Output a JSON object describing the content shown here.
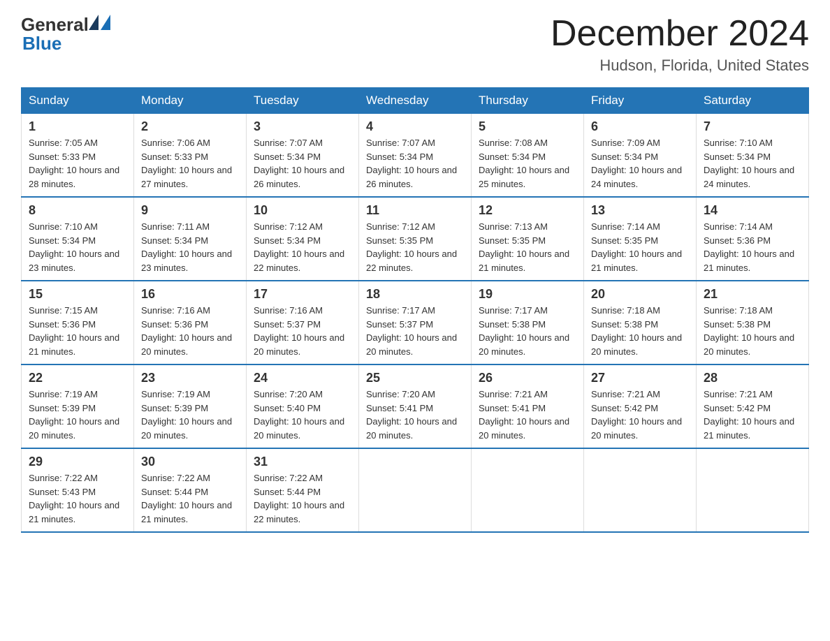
{
  "logo": {
    "general": "General",
    "blue": "Blue"
  },
  "title": "December 2024",
  "subtitle": "Hudson, Florida, United States",
  "days_header": [
    "Sunday",
    "Monday",
    "Tuesday",
    "Wednesday",
    "Thursday",
    "Friday",
    "Saturday"
  ],
  "weeks": [
    [
      {
        "num": "1",
        "sunrise": "7:05 AM",
        "sunset": "5:33 PM",
        "daylight": "10 hours and 28 minutes."
      },
      {
        "num": "2",
        "sunrise": "7:06 AM",
        "sunset": "5:33 PM",
        "daylight": "10 hours and 27 minutes."
      },
      {
        "num": "3",
        "sunrise": "7:07 AM",
        "sunset": "5:34 PM",
        "daylight": "10 hours and 26 minutes."
      },
      {
        "num": "4",
        "sunrise": "7:07 AM",
        "sunset": "5:34 PM",
        "daylight": "10 hours and 26 minutes."
      },
      {
        "num": "5",
        "sunrise": "7:08 AM",
        "sunset": "5:34 PM",
        "daylight": "10 hours and 25 minutes."
      },
      {
        "num": "6",
        "sunrise": "7:09 AM",
        "sunset": "5:34 PM",
        "daylight": "10 hours and 24 minutes."
      },
      {
        "num": "7",
        "sunrise": "7:10 AM",
        "sunset": "5:34 PM",
        "daylight": "10 hours and 24 minutes."
      }
    ],
    [
      {
        "num": "8",
        "sunrise": "7:10 AM",
        "sunset": "5:34 PM",
        "daylight": "10 hours and 23 minutes."
      },
      {
        "num": "9",
        "sunrise": "7:11 AM",
        "sunset": "5:34 PM",
        "daylight": "10 hours and 23 minutes."
      },
      {
        "num": "10",
        "sunrise": "7:12 AM",
        "sunset": "5:34 PM",
        "daylight": "10 hours and 22 minutes."
      },
      {
        "num": "11",
        "sunrise": "7:12 AM",
        "sunset": "5:35 PM",
        "daylight": "10 hours and 22 minutes."
      },
      {
        "num": "12",
        "sunrise": "7:13 AM",
        "sunset": "5:35 PM",
        "daylight": "10 hours and 21 minutes."
      },
      {
        "num": "13",
        "sunrise": "7:14 AM",
        "sunset": "5:35 PM",
        "daylight": "10 hours and 21 minutes."
      },
      {
        "num": "14",
        "sunrise": "7:14 AM",
        "sunset": "5:36 PM",
        "daylight": "10 hours and 21 minutes."
      }
    ],
    [
      {
        "num": "15",
        "sunrise": "7:15 AM",
        "sunset": "5:36 PM",
        "daylight": "10 hours and 21 minutes."
      },
      {
        "num": "16",
        "sunrise": "7:16 AM",
        "sunset": "5:36 PM",
        "daylight": "10 hours and 20 minutes."
      },
      {
        "num": "17",
        "sunrise": "7:16 AM",
        "sunset": "5:37 PM",
        "daylight": "10 hours and 20 minutes."
      },
      {
        "num": "18",
        "sunrise": "7:17 AM",
        "sunset": "5:37 PM",
        "daylight": "10 hours and 20 minutes."
      },
      {
        "num": "19",
        "sunrise": "7:17 AM",
        "sunset": "5:38 PM",
        "daylight": "10 hours and 20 minutes."
      },
      {
        "num": "20",
        "sunrise": "7:18 AM",
        "sunset": "5:38 PM",
        "daylight": "10 hours and 20 minutes."
      },
      {
        "num": "21",
        "sunrise": "7:18 AM",
        "sunset": "5:38 PM",
        "daylight": "10 hours and 20 minutes."
      }
    ],
    [
      {
        "num": "22",
        "sunrise": "7:19 AM",
        "sunset": "5:39 PM",
        "daylight": "10 hours and 20 minutes."
      },
      {
        "num": "23",
        "sunrise": "7:19 AM",
        "sunset": "5:39 PM",
        "daylight": "10 hours and 20 minutes."
      },
      {
        "num": "24",
        "sunrise": "7:20 AM",
        "sunset": "5:40 PM",
        "daylight": "10 hours and 20 minutes."
      },
      {
        "num": "25",
        "sunrise": "7:20 AM",
        "sunset": "5:41 PM",
        "daylight": "10 hours and 20 minutes."
      },
      {
        "num": "26",
        "sunrise": "7:21 AM",
        "sunset": "5:41 PM",
        "daylight": "10 hours and 20 minutes."
      },
      {
        "num": "27",
        "sunrise": "7:21 AM",
        "sunset": "5:42 PM",
        "daylight": "10 hours and 20 minutes."
      },
      {
        "num": "28",
        "sunrise": "7:21 AM",
        "sunset": "5:42 PM",
        "daylight": "10 hours and 21 minutes."
      }
    ],
    [
      {
        "num": "29",
        "sunrise": "7:22 AM",
        "sunset": "5:43 PM",
        "daylight": "10 hours and 21 minutes."
      },
      {
        "num": "30",
        "sunrise": "7:22 AM",
        "sunset": "5:44 PM",
        "daylight": "10 hours and 21 minutes."
      },
      {
        "num": "31",
        "sunrise": "7:22 AM",
        "sunset": "5:44 PM",
        "daylight": "10 hours and 22 minutes."
      },
      null,
      null,
      null,
      null
    ]
  ]
}
